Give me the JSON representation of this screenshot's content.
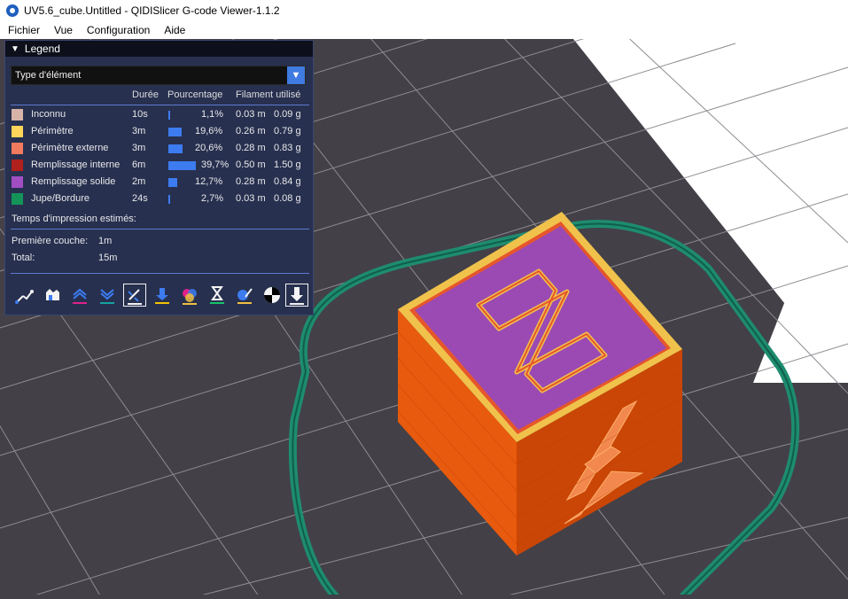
{
  "window": {
    "title": "UV5.6_cube.Untitled - QIDISlicer G-code Viewer-1.1.2"
  },
  "menu": {
    "items": [
      "Fichier",
      "Vue",
      "Configuration",
      "Aide"
    ]
  },
  "legend": {
    "header": "Legend",
    "view_type": "Type d'élément",
    "columns": {
      "time": "Durée",
      "percent": "Pourcentage",
      "filament": "Filament utilisé"
    },
    "rows": [
      {
        "label": "Inconnu",
        "time": "10s",
        "fraction": 0.011,
        "percent": "1,1%",
        "length": "0.03 m",
        "weight": "0.09 g",
        "color": "#d8b4a8"
      },
      {
        "label": "Périmètre",
        "time": "3m",
        "fraction": 0.196,
        "percent": "19,6%",
        "length": "0.26 m",
        "weight": "0.79 g",
        "color": "#ffd45a"
      },
      {
        "label": "Périmètre externe",
        "time": "3m",
        "fraction": 0.206,
        "percent": "20,6%",
        "length": "0.28 m",
        "weight": "0.83 g",
        "color": "#f27a5e"
      },
      {
        "label": "Remplissage interne",
        "time": "6m",
        "fraction": 0.397,
        "percent": "39,7%",
        "length": "0.50 m",
        "weight": "1.50 g",
        "color": "#b0201c"
      },
      {
        "label": "Remplissage solide",
        "time": "2m",
        "fraction": 0.127,
        "percent": "12,7%",
        "length": "0.28 m",
        "weight": "0.84 g",
        "color": "#a14ec2"
      },
      {
        "label": "Jupe/Bordure",
        "time": "24s",
        "fraction": 0.027,
        "percent": "2,7%",
        "length": "0.03 m",
        "weight": "0.08 g",
        "color": "#149458"
      }
    ],
    "estimated_title": "Temps d'impression estimés:",
    "first_layer_label": "Première couche:",
    "first_layer_value": "1m",
    "total_label": "Total:",
    "total_value": "15m"
  },
  "toolbar": {
    "icons": [
      "travel-icon",
      "wipe-icon",
      "retractions-icon",
      "deretractions-icon",
      "seams-icon",
      "tool-changes-icon",
      "color-changes-icon",
      "pause-prints-icon",
      "custom-gcodes-icon",
      "center-of-gravity-icon",
      "shells-icon"
    ],
    "accent_colors": [
      "#f4f4f4",
      "#f4f4f4",
      "#e0218a",
      "#17a2a2",
      "#f4f4f4",
      "#f2c200",
      "#f0c040",
      "#17c46a",
      "#f0f0f0",
      "#f4f4f4",
      "#f4f4f4"
    ]
  },
  "scene": {
    "bed_color": "#434047",
    "grid_color": "#8e8c91",
    "background": "#ffffff"
  }
}
